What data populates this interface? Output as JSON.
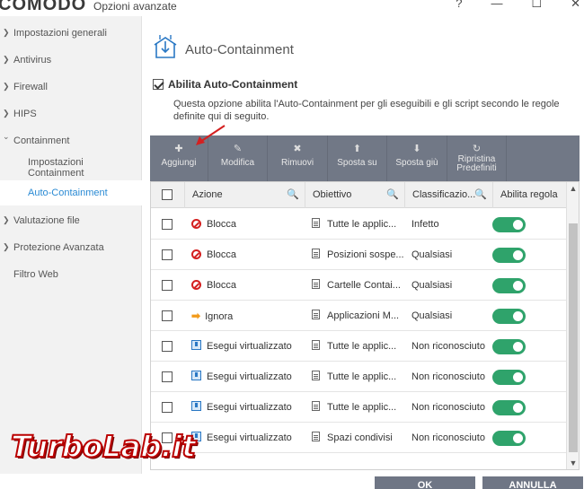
{
  "window": {
    "logo": "COMODO",
    "title": "Opzioni avanzate",
    "help": "?",
    "minimize": "—",
    "maximize": "☐",
    "close": "✕"
  },
  "sidebar": {
    "items": [
      {
        "label": "Impostazioni generali",
        "chevron": "❯"
      },
      {
        "label": "Antivirus",
        "chevron": "❯"
      },
      {
        "label": "Firewall",
        "chevron": "❯"
      },
      {
        "label": "HIPS",
        "chevron": "❯"
      },
      {
        "label": "Containment",
        "chevron": "⌄"
      },
      {
        "label": "Impostazioni Containment"
      },
      {
        "label": "Auto-Containment"
      },
      {
        "label": "Valutazione file",
        "chevron": "❯"
      },
      {
        "label": "Protezione Avanzata",
        "chevron": "❯"
      },
      {
        "label": "Filtro Web"
      }
    ]
  },
  "main": {
    "title": "Auto-Containment",
    "enable_label": "Abilita Auto-Containment",
    "description": "Questa opzione abilita l'Auto-Containment per gli eseguibili e gli script secondo le regole definite qui di seguito."
  },
  "toolbar": {
    "buttons": [
      {
        "icon": "✚",
        "label": "Aggiungi"
      },
      {
        "icon": "✎",
        "label": "Modifica"
      },
      {
        "icon": "✖",
        "label": "Rimuovi"
      },
      {
        "icon": "⬆",
        "label": "Sposta su"
      },
      {
        "icon": "⬇",
        "label": "Sposta giù"
      },
      {
        "icon": "↻",
        "label": "Ripristina Predefiniti"
      }
    ]
  },
  "table": {
    "headers": {
      "action": "Azione",
      "target": "Obiettivo",
      "rating": "Classificazio...",
      "enable": "Abilita regola",
      "search": "🔍"
    },
    "rows": [
      {
        "action": "Blocca",
        "icon": "block-icon",
        "target": "Tutte le applic...",
        "rating": "Infetto",
        "enabled": true
      },
      {
        "action": "Blocca",
        "icon": "block-icon",
        "target": "Posizioni sospe...",
        "rating": "Qualsiasi",
        "enabled": true
      },
      {
        "action": "Blocca",
        "icon": "block-icon",
        "target": "Cartelle Contai...",
        "rating": "Qualsiasi",
        "enabled": true
      },
      {
        "action": "Ignora",
        "icon": "arrow-right-icon",
        "target": "Applicazioni M...",
        "rating": "Qualsiasi",
        "enabled": true
      },
      {
        "action": "Esegui virtualizzato",
        "icon": "virtualize-icon",
        "target": "Tutte le applic...",
        "rating": "Non riconosciuto",
        "enabled": true
      },
      {
        "action": "Esegui virtualizzato",
        "icon": "virtualize-icon",
        "target": "Tutte le applic...",
        "rating": "Non riconosciuto",
        "enabled": true
      },
      {
        "action": "Esegui virtualizzato",
        "icon": "virtualize-icon",
        "target": "Tutte le applic...",
        "rating": "Non riconosciuto",
        "enabled": true
      },
      {
        "action": "Esegui virtualizzato",
        "icon": "virtualize-icon",
        "target": "Spazi condivisi",
        "rating": "Non riconosciuto",
        "enabled": true
      }
    ]
  },
  "footer": {
    "ok": "OK",
    "cancel": "ANNULLA"
  },
  "watermark": "TurboLab.it",
  "colors": {
    "accent": "#2a8ad4",
    "toolbar": "#717886",
    "toggle_on": "#2fa36b",
    "block_red": "#d42020",
    "ignore_orange": "#f29a1a",
    "annotation_red": "#d42020"
  }
}
